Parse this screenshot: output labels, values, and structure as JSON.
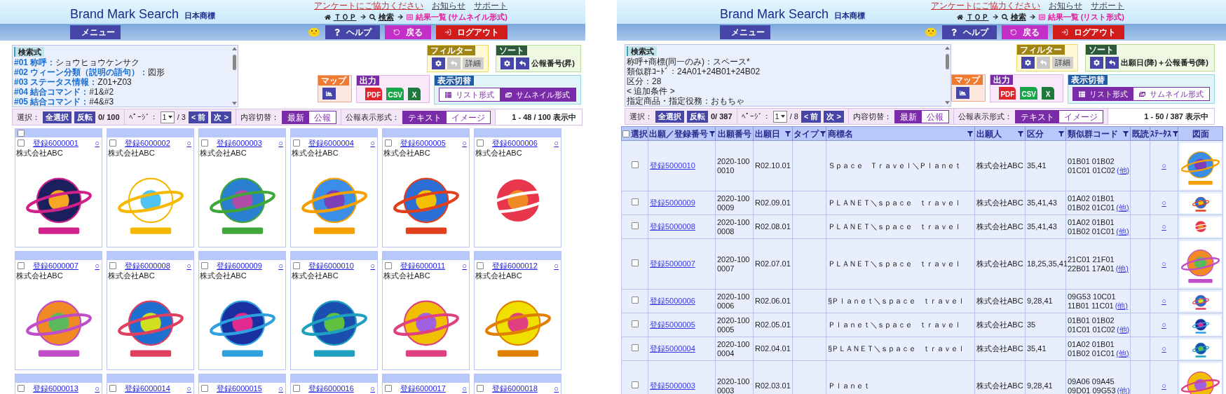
{
  "panels": [
    {
      "header": {
        "title": "Brand Mark Search",
        "subtitle": "日本商標",
        "links": [
          {
            "label": "アンケートにご協力ください",
            "kind": "survey"
          },
          {
            "label": "お知らせ",
            "kind": "plain"
          },
          {
            "label": "サポート",
            "kind": "plain"
          }
        ],
        "breadcrumb": [
          {
            "label": "ＴＯＰ",
            "kind": "home"
          },
          {
            "label": "検索",
            "kind": "search"
          },
          {
            "label": "結果一覧 (サムネイル形式)",
            "kind": "current"
          }
        ],
        "buttons": [
          {
            "label": "メニュー",
            "kind": "menu"
          },
          {
            "label": "ヘルプ",
            "kind": "help"
          },
          {
            "label": "戻る",
            "kind": "back"
          },
          {
            "label": "ログアウト",
            "kind": "logout"
          }
        ]
      },
      "search_formula": {
        "title": "検索式",
        "lines": [
          {
            "label": "#01 称呼：",
            "value": "ショウヒョウケンサク"
          },
          {
            "label": "#02 ウィーン分類（説明の語句）：",
            "value": "図形"
          },
          {
            "label": "#03 ステータス情報：",
            "value": "Z01+Z03"
          },
          {
            "label": "#04 結合コマンド：",
            "value": "#1&#2"
          },
          {
            "label": "#05 結合コマンド：",
            "value": "#4&#3"
          }
        ]
      },
      "filter": {
        "title": "フィルター",
        "detail": "詳細",
        "detail_disabled": true
      },
      "sort": {
        "title": "ソート",
        "value": "公報番号(昇)"
      },
      "map": {
        "title": "マップ"
      },
      "output": {
        "title": "出力",
        "files": [
          {
            "label": "PDF",
            "kind": "pdf"
          },
          {
            "label": "CSV",
            "kind": "csv"
          },
          {
            "label": "X",
            "kind": "excel"
          }
        ]
      },
      "view_switch": {
        "title": "表示切替",
        "options": [
          {
            "label": "リスト形式",
            "kind": "list",
            "selected": false
          },
          {
            "label": "サムネイル形式",
            "kind": "thumb",
            "selected": true
          }
        ]
      },
      "toolbar": {
        "select_label": "選択：",
        "select_all": "全選択",
        "invert": "反転",
        "count": "0/ 100",
        "page_label": "ﾍﾟｰｼﾞ：",
        "page": "1",
        "page_total": "/ 3",
        "prev": "< 前",
        "next": "次 >",
        "content_label": "内容切替：",
        "content_options": [
          {
            "label": "最新",
            "selected": true
          },
          {
            "label": "公報",
            "selected": false
          }
        ],
        "format_label": "公報表示形式：",
        "format_options": [
          {
            "label": "テキスト",
            "selected": true
          },
          {
            "label": "イメージ",
            "selected": false
          }
        ],
        "range": "1 - 48 / 100 表示中"
      },
      "results": {
        "kind": "grid",
        "select_all_checked": false,
        "cards": [
          {
            "number": "登録6000001",
            "applicant": "株式会社ABC",
            "status": "○",
            "checked": false
          },
          {
            "number": "登録6000002",
            "applicant": "株式会社ABC",
            "status": "○",
            "checked": false
          },
          {
            "number": "登録6000003",
            "applicant": "株式会社ABC",
            "status": "○",
            "checked": false
          },
          {
            "number": "登録6000004",
            "applicant": "株式会社ABC",
            "status": "○",
            "checked": false
          },
          {
            "number": "登録6000005",
            "applicant": "株式会社ABC",
            "status": "○",
            "checked": false
          },
          {
            "number": "登録6000006",
            "applicant": "株式会社ABC",
            "status": "○",
            "checked": false
          },
          {
            "number": "登録6000007",
            "applicant": "株式会社ABC",
            "status": "○",
            "checked": false
          },
          {
            "number": "登録6000008",
            "applicant": "株式会社ABC",
            "status": "○",
            "checked": false
          },
          {
            "number": "登録6000009",
            "applicant": "株式会社ABC",
            "status": "○",
            "checked": false
          },
          {
            "number": "登録6000010",
            "applicant": "株式会社ABC",
            "status": "○",
            "checked": false
          },
          {
            "number": "登録6000011",
            "applicant": "株式会社ABC",
            "status": "○",
            "checked": false
          },
          {
            "number": "登録6000012",
            "applicant": "株式会社ABC",
            "status": "○",
            "checked": false
          },
          {
            "number": "登録6000013",
            "status": "○",
            "checked": false
          },
          {
            "number": "登録6000014",
            "status": "○",
            "checked": false
          },
          {
            "number": "登録6000015",
            "status": "○",
            "checked": false
          },
          {
            "number": "登録6000016",
            "status": "○",
            "checked": false
          },
          {
            "number": "登録6000017",
            "status": "○",
            "checked": false
          },
          {
            "number": "登録6000018",
            "status": "○",
            "checked": false
          }
        ]
      }
    },
    {
      "header": {
        "title": "Brand Mark Search",
        "subtitle": "日本商標",
        "links": [
          {
            "label": "アンケートにご協力ください",
            "kind": "survey"
          },
          {
            "label": "お知らせ",
            "kind": "plain"
          },
          {
            "label": "サポート",
            "kind": "plain"
          }
        ],
        "breadcrumb": [
          {
            "label": "ＴＯＰ",
            "kind": "home"
          },
          {
            "label": "検索",
            "kind": "search"
          },
          {
            "label": "結果一覧 (リスト形式)",
            "kind": "current"
          }
        ],
        "buttons": [
          {
            "label": "メニュー",
            "kind": "menu"
          },
          {
            "label": "ヘルプ",
            "kind": "help"
          },
          {
            "label": "戻る",
            "kind": "back"
          },
          {
            "label": "ログアウト",
            "kind": "logout"
          }
        ]
      },
      "search_formula": {
        "title": "検索式",
        "lines": [
          {
            "value": "称呼+商標(同一のみ)：スペース*"
          },
          {
            "value": "類似群ｺｰﾄﾞ：24A01+24B01+24B02"
          },
          {
            "value": "区分：28"
          },
          {
            "value": "< 追加条件 >"
          },
          {
            "value": "指定商品・指定役務：おもちゃ"
          }
        ]
      },
      "filter": {
        "title": "フィルター",
        "detail": "詳細",
        "detail_disabled": true
      },
      "sort": {
        "title": "ソート",
        "value": "出願日(降)＋公報番号(降)"
      },
      "map": {
        "title": "マップ"
      },
      "output": {
        "title": "出力",
        "files": [
          {
            "label": "PDF",
            "kind": "pdf"
          },
          {
            "label": "CSV",
            "kind": "csv"
          },
          {
            "label": "X",
            "kind": "excel"
          }
        ]
      },
      "view_switch": {
        "title": "表示切替",
        "options": [
          {
            "label": "リスト形式",
            "kind": "list",
            "selected": true
          },
          {
            "label": "サムネイル形式",
            "kind": "thumb",
            "selected": false
          }
        ]
      },
      "toolbar": {
        "select_label": "選択：",
        "select_all": "全選択",
        "invert": "反転",
        "count": "0/ 387",
        "page_label": "ﾍﾟｰｼﾞ：",
        "page": "1",
        "page_total": "/ 8",
        "prev": "< 前",
        "next": "次 >",
        "content_label": "内容切替：",
        "content_options": [
          {
            "label": "最新",
            "selected": true
          },
          {
            "label": "公報",
            "selected": false
          }
        ],
        "format_label": "公報表示形式：",
        "format_options": [
          {
            "label": "テキスト",
            "selected": true
          },
          {
            "label": "イメージ",
            "selected": false
          }
        ],
        "range": "1 - 50 / 387 表示中"
      },
      "results": {
        "kind": "table",
        "select_all_checked": false,
        "columns": [
          {
            "label": "選択",
            "filter": false
          },
          {
            "label": "出願／登録番号",
            "filter": true
          },
          {
            "label": "出願番号",
            "filter": false
          },
          {
            "label": "出願日",
            "filter": true
          },
          {
            "label": "タイプ",
            "filter": true
          },
          {
            "label": "商標名",
            "filter": true
          },
          {
            "label": "出願人",
            "filter": true
          },
          {
            "label": "区分",
            "filter": true
          },
          {
            "label": "類似群コード",
            "filter": true
          },
          {
            "label": "既読",
            "filter": false
          },
          {
            "label": "ｽﾃｰﾀｽ",
            "filter": true
          },
          {
            "label": "図面",
            "filter": false
          }
        ],
        "rows": [
          {
            "checked": false,
            "number": "登録5000010",
            "app_no": "2020-1000010",
            "date": "R02.10.01",
            "name": "Ｓｐａｃｅ　Ｔｒａｖｅｌ＼Ｐｌａｎｅｔ",
            "applicant": "株式会社ABC",
            "classes": "35,41",
            "codes": [
              "01B01 01B02",
              "01C01 01C02"
            ],
            "more": "(他)",
            "status": "○",
            "kind": "tall"
          },
          {
            "checked": false,
            "number": "登録5000009",
            "app_no": "2020-1000009",
            "date": "R02.09.01",
            "name": "ＰＬＡＮＥＴ＼ｓｐａｃｅ　ｔｒａｖｅｌ",
            "applicant": "株式会社ABC",
            "classes": "35,41,43",
            "codes": [
              "01A02 01B01",
              "01B02 01C01"
            ],
            "more": "(他)",
            "status": "○",
            "kind": "wide"
          },
          {
            "checked": false,
            "number": "登録5000008",
            "app_no": "2020-1000008",
            "date": "R02.08.01",
            "name": "ＰＬＡＮＥＴ＼ｓｐａｃｅ　ｔｒａｖｅｌ",
            "applicant": "株式会社ABC",
            "classes": "35,41,43",
            "codes": [
              "01A02 01B01",
              "01B02 01C01"
            ],
            "more": "(他)",
            "status": "○",
            "kind": "wide"
          },
          {
            "checked": false,
            "number": "登録5000007",
            "app_no": "2020-1000007",
            "date": "R02.07.01",
            "name": "ＰＬＡＮＥＴ＼ｓｐａｃｅ　ｔｒａｖｅｌ",
            "applicant": "株式会社ABC",
            "classes": "18,25,35,41",
            "codes": [
              "21C01 21F01",
              "22B01 17A01"
            ],
            "more": "(他)",
            "status": "○",
            "kind": "tall"
          },
          {
            "checked": false,
            "number": "登録5000006",
            "app_no": "2020-1000006",
            "date": "R02.06.01",
            "name": "§Ｐｌａｎｅｔ＼ｓｐａｃｅ　ｔｒａｖｅｌ",
            "applicant": "株式会社ABC",
            "classes": "9,28,41",
            "codes": [
              "09G53 10C01",
              "11B01 11C01"
            ],
            "more": "(他)",
            "status": "○",
            "kind": "wide"
          },
          {
            "checked": false,
            "number": "登録5000005",
            "app_no": "2020-1000005",
            "date": "R02.05.01",
            "name": "Ｐｌａｎｅｔ＼ｓｐａｃｅ　ｔｒａｖｅｌ",
            "applicant": "株式会社ABC",
            "classes": "35",
            "codes": [
              "01B01 01B02",
              "01C01 01C02"
            ],
            "more": "(他)",
            "status": "○",
            "kind": "wide"
          },
          {
            "checked": false,
            "number": "登録5000004",
            "app_no": "2020-1000004",
            "date": "R02.04.01",
            "name": "§ＰＬＡＮＥＴ＼ｓｐａｃｅ　ｔｒａｖｅｌ",
            "applicant": "株式会社ABC",
            "classes": "35,41",
            "codes": [
              "01A02 01B01",
              "01B02 01C01"
            ],
            "more": "(他)",
            "status": "○",
            "kind": "wide"
          },
          {
            "checked": false,
            "number": "登録5000003",
            "app_no": "2020-1000003",
            "date": "R02.03.01",
            "name": "Ｐｌａｎｅｔ",
            "applicant": "株式会社ABC",
            "classes": "9,28,41",
            "codes": [
              "09A06 09A45",
              "09D01 09G53"
            ],
            "more": "(他)",
            "status": "○",
            "kind": "tall"
          }
        ]
      }
    }
  ]
}
